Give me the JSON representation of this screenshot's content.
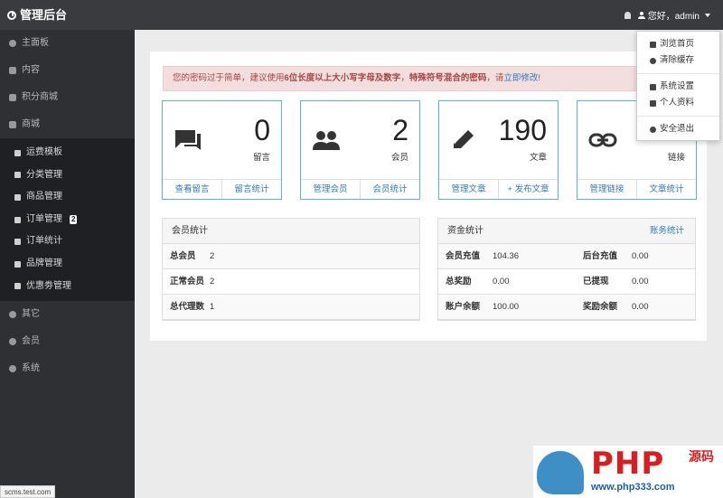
{
  "header": {
    "title": "管理后台",
    "greeting": "您好，admin"
  },
  "sidebar": {
    "items": [
      {
        "label": "主面板"
      },
      {
        "label": "内容"
      },
      {
        "label": "积分商城"
      },
      {
        "label": "商城"
      }
    ],
    "submenu": [
      {
        "label": "运费模板"
      },
      {
        "label": "分类管理"
      },
      {
        "label": "商品管理"
      },
      {
        "label": "订单管理",
        "badge": "2"
      },
      {
        "label": "订单统计"
      },
      {
        "label": "品牌管理"
      },
      {
        "label": "优惠劵管理"
      }
    ],
    "bottom_items": [
      {
        "label": "其它"
      },
      {
        "label": "会员"
      },
      {
        "label": "系统"
      }
    ]
  },
  "status_url": "scms.test.com",
  "alert": {
    "prefix": "您的密码过于简单，建议使用",
    "bold1": "6位长度以上大小写字母及数字",
    "mid": "，",
    "bold2": "特殊符号混合的密码",
    "suffix": "，请",
    "link": "立即修改",
    "end": "!"
  },
  "cards": [
    {
      "value": "0",
      "label": "留言",
      "actions": [
        "查看留言",
        "留言统计"
      ],
      "icon": "chat-icon"
    },
    {
      "value": "2",
      "label": "会员",
      "actions": [
        "管理会员",
        "会员统计"
      ],
      "icon": "people-icon"
    },
    {
      "value": "190",
      "label": "文章",
      "actions": [
        "管理文章",
        "+ 发布文章"
      ],
      "icon": "pencil-icon"
    },
    {
      "value": "",
      "label": "链接",
      "actions": [
        "管理链接",
        "文章统计"
      ],
      "icon": "link-icon"
    }
  ],
  "member_stats": {
    "title": "会员统计",
    "rows": [
      {
        "k": "总会员",
        "v": "2"
      },
      {
        "k": "正常会员",
        "v": "2"
      },
      {
        "k": "总代理数",
        "v": "1"
      }
    ]
  },
  "fund_stats": {
    "title": "资金统计",
    "link": "账务统计",
    "rows": [
      {
        "k1": "会员充值",
        "v1": "104.36",
        "k2": "后台充值",
        "v2": "0.00"
      },
      {
        "k1": "总奖励",
        "v1": "0.00",
        "k2": "已提现",
        "v2": "0.00"
      },
      {
        "k1": "账户余额",
        "v1": "100.00",
        "k2": "奖励余额",
        "v2": "0.00"
      }
    ]
  },
  "dropdown": {
    "items": [
      "浏览首页",
      "清除缓存",
      "系统设置",
      "个人资料",
      "安全退出"
    ]
  },
  "watermark": {
    "brand": "PHP",
    "cn": "源码",
    "url": "www.php333.com"
  },
  "colors": {
    "topbar": "#3a3b3f",
    "sidebar": "#2f3034",
    "card_border": "#5ab6c2",
    "link": "#337ab7",
    "alert_bg": "#f2dede"
  }
}
